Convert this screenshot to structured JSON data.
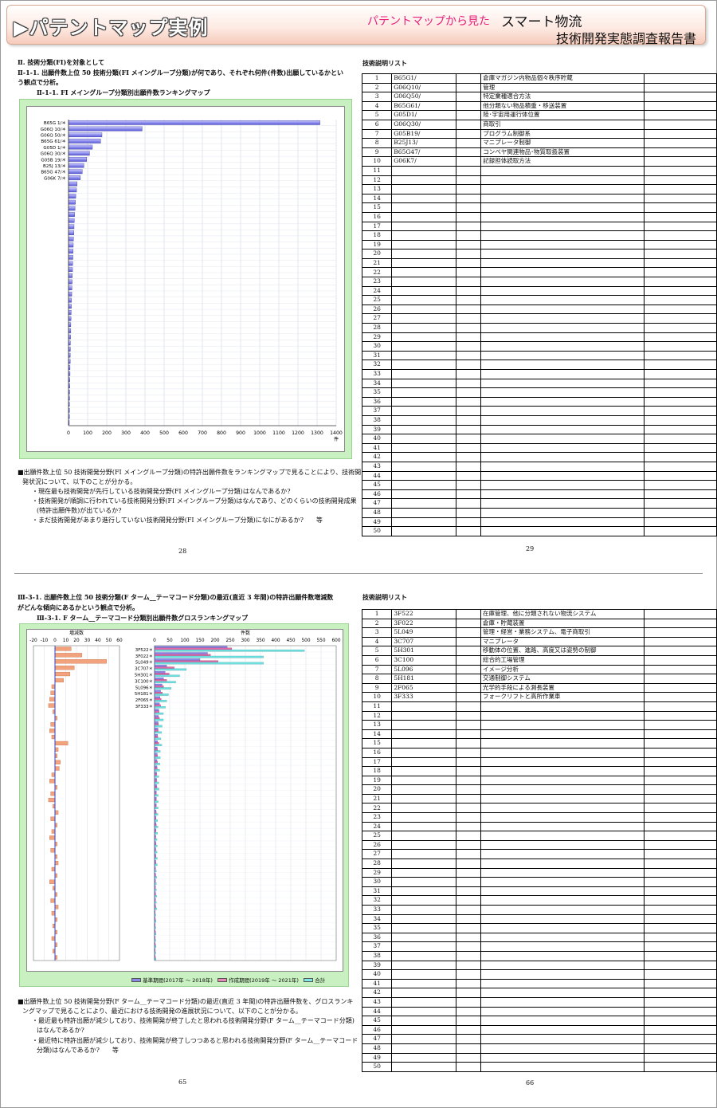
{
  "header": {
    "title": "▶パテントマップ実例",
    "subtitle": "パテントマップから見た",
    "report_line1": "スマート物流",
    "report_line2": "技術開発実態調査報告書"
  },
  "page1": {
    "section": "Ⅱ. 技術分類(FI)を対象として",
    "heading_line1": "Ⅱ-1-1. 出願件数上位 50 技術分類(FI メイングループ分類)が何であり、それぞれ何件(件数)出願しているかとい",
    "heading_line2": "う観点で分析。",
    "chart_caption": "Ⅱ-1-1. FI メイングループ分類別出願件数ランキングマップ",
    "axis_unit": "件",
    "note_line1": "■出願件数上位 50 技術開発分野(FI メイングループ分類)の特許出願件数をランキングマップで見ることにより、技術開",
    "note_line2": "発状況について、以下のことが分かる。",
    "bullet1": "・現在最も技術開発が先行している技術開発分野(FI メイングループ分類)はなんであるか?",
    "bullet2": "・技術開発が順調に行われている技術開発分野(FI メイングループ分類)はなんであり、どのくらいの技術開発成果",
    "bullet2b": "(特許出願件数)が出ているか?",
    "bullet3": "・まだ技術開発があまり進行していない技術開発分野(FI メイングループ分類)になにがあるか?　　等",
    "page_left": "28",
    "list_title": "技術説明リスト",
    "page_right": "29"
  },
  "page2": {
    "heading_line1": "Ⅲ-3-1. 出願件数上位 50 技術分類(F ターム__テーマコード分類)の最近(直近 3 年間)の特許出願件数増減数",
    "heading_line2": "がどんな傾向にあるかという観点で分析。",
    "chart_caption": "Ⅲ-3-1. F ターム__テーマコード分類別出願件数グロスランキングマップ",
    "left_axis_title": "増減数",
    "right_axis_title": "件数",
    "legend": [
      "基準期間(2017年 ～ 2018年)",
      "作成期間(2019年 ～ 2021年)",
      "合計"
    ],
    "note_line1": "■出願件数上位 50 技術開発分野(F ターム__テーマコード分類)の最近(直近 3 年間)の特許出願件数を、グロスランキ",
    "note_line2": "ングマップで見ることにより、最近における技術開発の進展状況について、以下のことが分かる。",
    "bullet1": "・最近最も特許出願が減少しており、技術開発が終了したと思われる技術開発分野(F ターム__テーマコード分類)",
    "bullet1b": "はなんであるか?",
    "bullet2": "・最近特に特許出願が減少しており、技術開発が終了しつつあると思われる技術開発分野(F ターム__テーマコード",
    "bullet2b": "分類)はなんであるか?　　等",
    "page_left": "65",
    "list_title": "技術説明リスト",
    "page_right": "66"
  },
  "list1": [
    {
      "no": "1",
      "code": "B65G1/",
      "desc": "倉庫マガジン内物品個々秩序貯蔵"
    },
    {
      "no": "2",
      "code": "G06Q10/",
      "desc": "管理"
    },
    {
      "no": "3",
      "code": "G06Q50/",
      "desc": "特定業種適合方法"
    },
    {
      "no": "4",
      "code": "B65G61/",
      "desc": "他分類ない物品積重・移送装置"
    },
    {
      "no": "5",
      "code": "G05D1/",
      "desc": "陸･宇宙用運行体位置"
    },
    {
      "no": "6",
      "code": "G06Q30/",
      "desc": "商取引"
    },
    {
      "no": "7",
      "code": "G05B19/",
      "desc": "プログラム制御系"
    },
    {
      "no": "8",
      "code": "B25J13/",
      "desc": "マニプレータ制御"
    },
    {
      "no": "9",
      "code": "B65G47/",
      "desc": "コンベヤ関連物品･物質取扱装置"
    },
    {
      "no": "10",
      "code": "G06K7/",
      "desc": "記録担体読取方法"
    }
  ],
  "list2": [
    {
      "no": "1",
      "code": "3F522",
      "desc": "在庫管理、他に分類されない物流システム"
    },
    {
      "no": "2",
      "code": "3F022",
      "desc": "倉庫・貯蔵装置"
    },
    {
      "no": "3",
      "code": "5L049",
      "desc": "管理・経営・業務システム、電子商取引"
    },
    {
      "no": "4",
      "code": "3C707",
      "desc": "マニプレータ"
    },
    {
      "no": "5",
      "code": "5H301",
      "desc": "移動体の位置、進路、高度又は姿勢の制御"
    },
    {
      "no": "6",
      "code": "3C100",
      "desc": "総合的工場管理"
    },
    {
      "no": "7",
      "code": "5L096",
      "desc": "イメージ分析"
    },
    {
      "no": "8",
      "code": "5H181",
      "desc": "交通制御システム"
    },
    {
      "no": "9",
      "code": "2F065",
      "desc": "光学的手段による測長装置"
    },
    {
      "no": "10",
      "code": "3F333",
      "desc": "フォークリフトと高所作業車"
    }
  ],
  "chart_data": [
    {
      "type": "bar",
      "orientation": "horizontal",
      "title": "Ⅱ-1-1. FI メイングループ分類別出願件数ランキングマップ",
      "xlabel": "件",
      "xlim": [
        0,
        1400
      ],
      "xticks": [
        0,
        100,
        200,
        300,
        400,
        500,
        600,
        700,
        800,
        900,
        1000,
        1100,
        1200,
        1300,
        1400
      ],
      "categories": [
        "B65G 1/＊",
        "G06Q 10/＊",
        "G06Q 50/＊",
        "B65G 61/＊",
        "G05D 1/＊",
        "G06Q 30/＊",
        "G05B 19/＊",
        "B25J 13/＊",
        "B65G 47/＊",
        "G06K 7/＊",
        "",
        "",
        "",
        "",
        "",
        "",
        "",
        "",
        "",
        "",
        "",
        "",
        "",
        "",
        "",
        "",
        "",
        "",
        "",
        "",
        "",
        "",
        "",
        "",
        "",
        "",
        "",
        "",
        "",
        "",
        "",
        "",
        "",
        "",
        "",
        "",
        "",
        "",
        "",
        ""
      ],
      "values": [
        1315,
        385,
        175,
        168,
        125,
        110,
        95,
        80,
        72,
        62,
        45,
        42,
        38,
        36,
        34,
        32,
        30,
        29,
        28,
        26,
        25,
        24,
        23,
        22,
        21,
        20,
        19,
        18,
        17,
        16,
        15,
        14,
        13,
        12,
        12,
        11,
        10,
        10,
        9,
        9,
        8,
        8,
        7,
        7,
        6,
        6,
        5,
        5,
        5,
        4
      ],
      "grid": true
    },
    {
      "type": "bar",
      "orientation": "horizontal",
      "title": "Ⅲ-3-1. F ターム__テーマコード分類別出願件数グロスランキングマップ",
      "left_panel": {
        "label": "増減数",
        "xlim": [
          -20,
          60
        ],
        "xticks": [
          -20,
          -10,
          0,
          10,
          20,
          30,
          40,
          50,
          60
        ],
        "values": [
          15,
          25,
          48,
          18,
          14,
          8,
          -3,
          -4,
          -5,
          -6,
          -2,
          2,
          -4,
          -5,
          -3,
          12,
          3,
          2,
          5,
          4,
          -3,
          -5,
          2,
          -4,
          -6,
          -2,
          3,
          -4,
          2,
          -3,
          -5,
          2,
          -4,
          2,
          3,
          -3,
          2,
          -5,
          -2,
          2,
          -4,
          3,
          -3,
          2,
          -2,
          2,
          -3,
          2,
          -2,
          2
        ]
      },
      "right_panel": {
        "label": "件数",
        "xlim": [
          0,
          600
        ],
        "xticks": [
          0,
          50,
          100,
          150,
          200,
          250,
          300,
          350,
          400,
          450,
          500,
          550,
          600
        ]
      },
      "categories": [
        "3F522＊",
        "3F022＊",
        "5L049＊",
        "3C707＊",
        "5H301＊",
        "3C100＊",
        "5L096＊",
        "5H181＊",
        "2F065＊",
        "3F333＊",
        "",
        "",
        "",
        "",
        "",
        "",
        "",
        "",
        "",
        "",
        "",
        "",
        "",
        "",
        "",
        "",
        "",
        "",
        "",
        "",
        "",
        "",
        "",
        "",
        "",
        "",
        "",
        "",
        "",
        "",
        "",
        "",
        "",
        "",
        "",
        "",
        "",
        "",
        "",
        ""
      ],
      "series": [
        {
          "name": "基準期間(2017年 ～ 2018年)",
          "values": [
            240,
            175,
            150,
            40,
            35,
            30,
            25,
            20,
            18,
            16,
            14,
            13,
            12,
            11,
            10,
            10,
            9,
            9,
            8,
            8,
            7,
            7,
            7,
            6,
            6,
            6,
            5,
            5,
            5,
            5,
            4,
            4,
            4,
            4,
            4,
            3,
            3,
            3,
            3,
            3,
            3,
            3,
            2,
            2,
            2,
            2,
            2,
            2,
            2,
            2
          ]
        },
        {
          "name": "作成期間(2019年 ～ 2021年)",
          "values": [
            255,
            185,
            210,
            65,
            48,
            40,
            30,
            26,
            22,
            20,
            15,
            16,
            13,
            12,
            11,
            14,
            10,
            10,
            10,
            9,
            7,
            7,
            8,
            6,
            6,
            6,
            6,
            5,
            6,
            5,
            4,
            5,
            4,
            5,
            5,
            3,
            4,
            3,
            3,
            4,
            3,
            4,
            2,
            3,
            2,
            3,
            2,
            3,
            2,
            3
          ]
        },
        {
          "name": "合計",
          "values": [
            495,
            360,
            360,
            105,
            83,
            70,
            55,
            46,
            40,
            36,
            29,
            29,
            25,
            23,
            21,
            24,
            19,
            19,
            18,
            17,
            14,
            14,
            15,
            12,
            12,
            12,
            11,
            10,
            11,
            10,
            8,
            9,
            8,
            9,
            9,
            6,
            7,
            6,
            6,
            7,
            6,
            7,
            4,
            5,
            4,
            5,
            4,
            5,
            4,
            5
          ]
        }
      ],
      "grid": true
    }
  ]
}
